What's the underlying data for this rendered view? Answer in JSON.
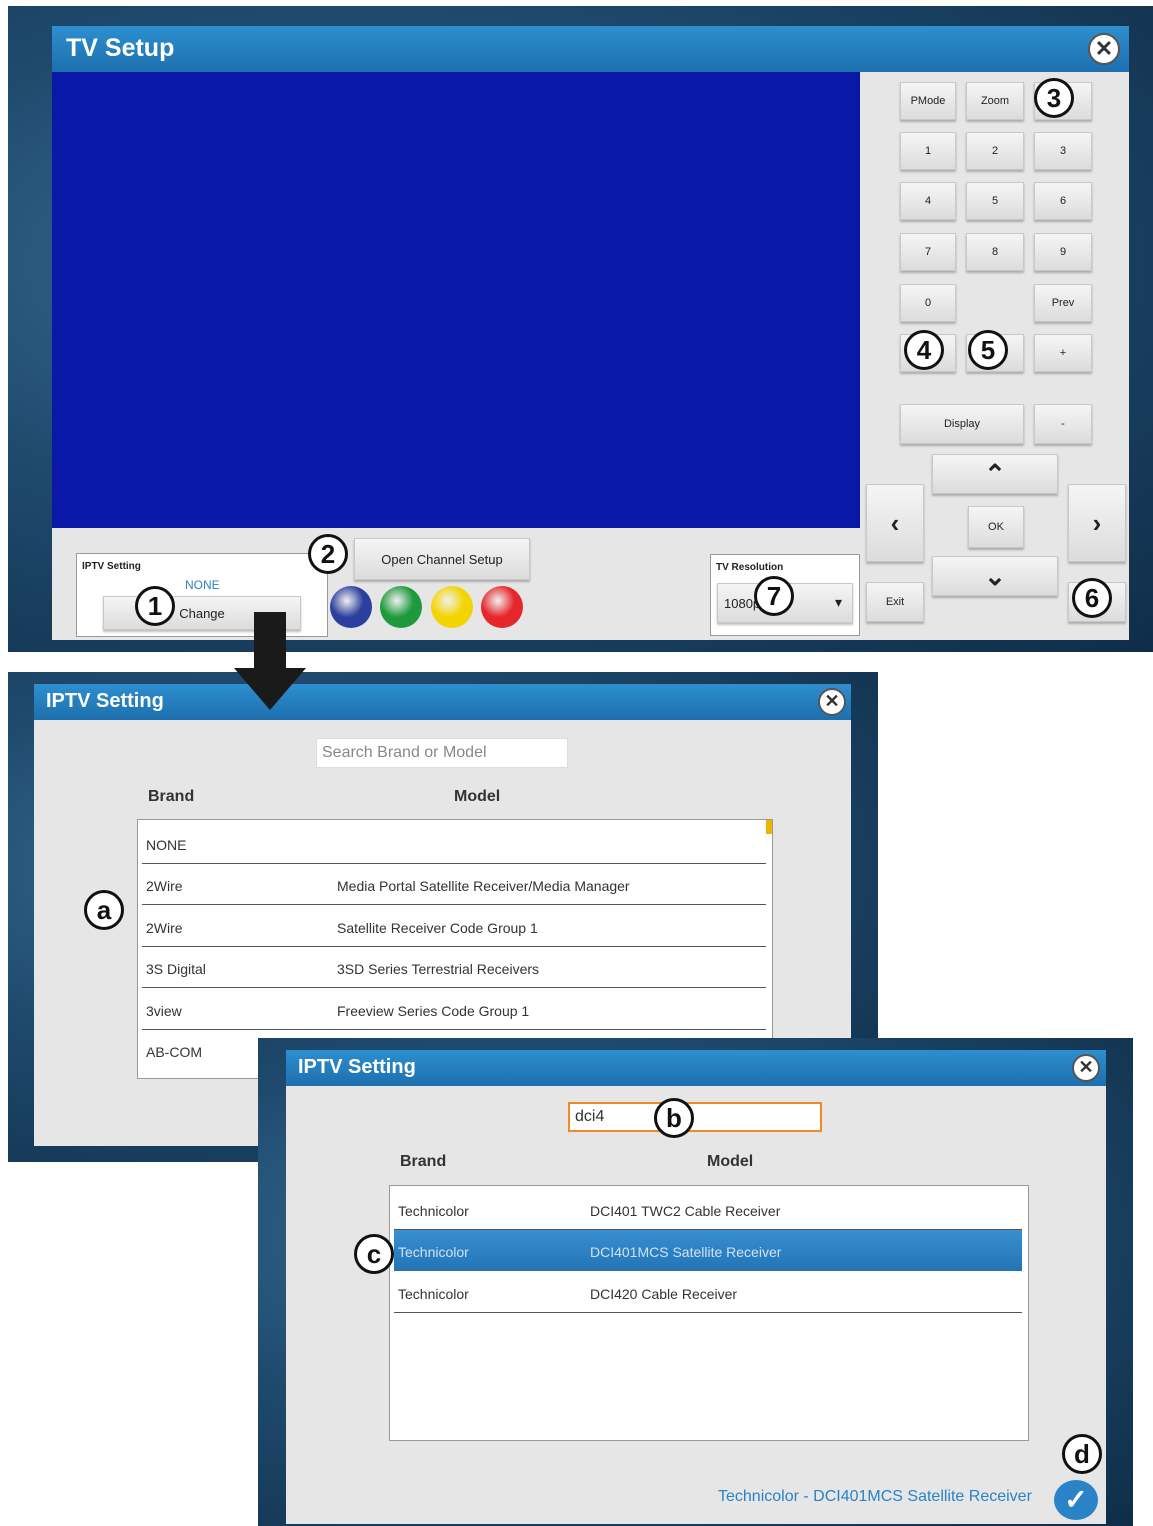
{
  "tv_setup": {
    "title": "TV Setup",
    "close_glyph": "✕",
    "keypad": {
      "pmode": "PMode",
      "zoom": "Zoom",
      "digits": [
        "1",
        "2",
        "3",
        "4",
        "5",
        "6",
        "7",
        "8",
        "9",
        "0"
      ],
      "prev": "Prev",
      "plus": "+",
      "display": "Display",
      "minus": "-",
      "up": "⌃",
      "down": "⌄",
      "left": "‹",
      "right": "›",
      "ok": "OK",
      "exit": "Exit"
    },
    "iptv_setting": {
      "title": "IPTV Setting",
      "value": "NONE",
      "change_label": "Change"
    },
    "open_channel_setup": "Open Channel Setup",
    "color_buttons": [
      "#2b3f9e",
      "#1e9a3c",
      "#f2d500",
      "#e5262a"
    ],
    "tv_resolution": {
      "title": "TV Resolution",
      "value": "1080p",
      "dropdown_glyph": "▾"
    },
    "callouts": [
      "1",
      "2",
      "3",
      "4",
      "5",
      "6",
      "7"
    ],
    "screen_color": "#0a18a8"
  },
  "iptv_dialog_1": {
    "title": "IPTV Setting",
    "close_glyph": "✕",
    "search_placeholder": "Search Brand or Model",
    "headers": {
      "brand": "Brand",
      "model": "Model"
    },
    "rows": [
      {
        "brand": "NONE",
        "model": ""
      },
      {
        "brand": "2Wire",
        "model": "Media Portal Satellite Receiver/Media Manager"
      },
      {
        "brand": "2Wire",
        "model": "Satellite Receiver Code Group 1"
      },
      {
        "brand": "3S Digital",
        "model": "3SD Series Terrestrial Receivers"
      },
      {
        "brand": "3view",
        "model": "Freeview Series Code Group 1"
      },
      {
        "brand": "AB-COM",
        "model": ""
      }
    ],
    "callout": "a"
  },
  "iptv_dialog_2": {
    "title": "IPTV Setting",
    "close_glyph": "✕",
    "search_value": "dci4",
    "headers": {
      "brand": "Brand",
      "model": "Model"
    },
    "rows": [
      {
        "brand": "Technicolor",
        "model": "DCI401 TWC2 Cable Receiver"
      },
      {
        "brand": "Technicolor",
        "model": "DCI401MCS Satellite Receiver"
      },
      {
        "brand": "Technicolor",
        "model": "DCI420 Cable Receiver"
      }
    ],
    "selected_index": 1,
    "selection_summary": "Technicolor - DCI401MCS Satellite Receiver",
    "confirm_glyph": "✓",
    "callouts": [
      "b",
      "c",
      "d"
    ]
  },
  "colors": {
    "titlebar": "#1d6fae",
    "accent": "#2a82c7",
    "search_focus": "#f08a24"
  }
}
